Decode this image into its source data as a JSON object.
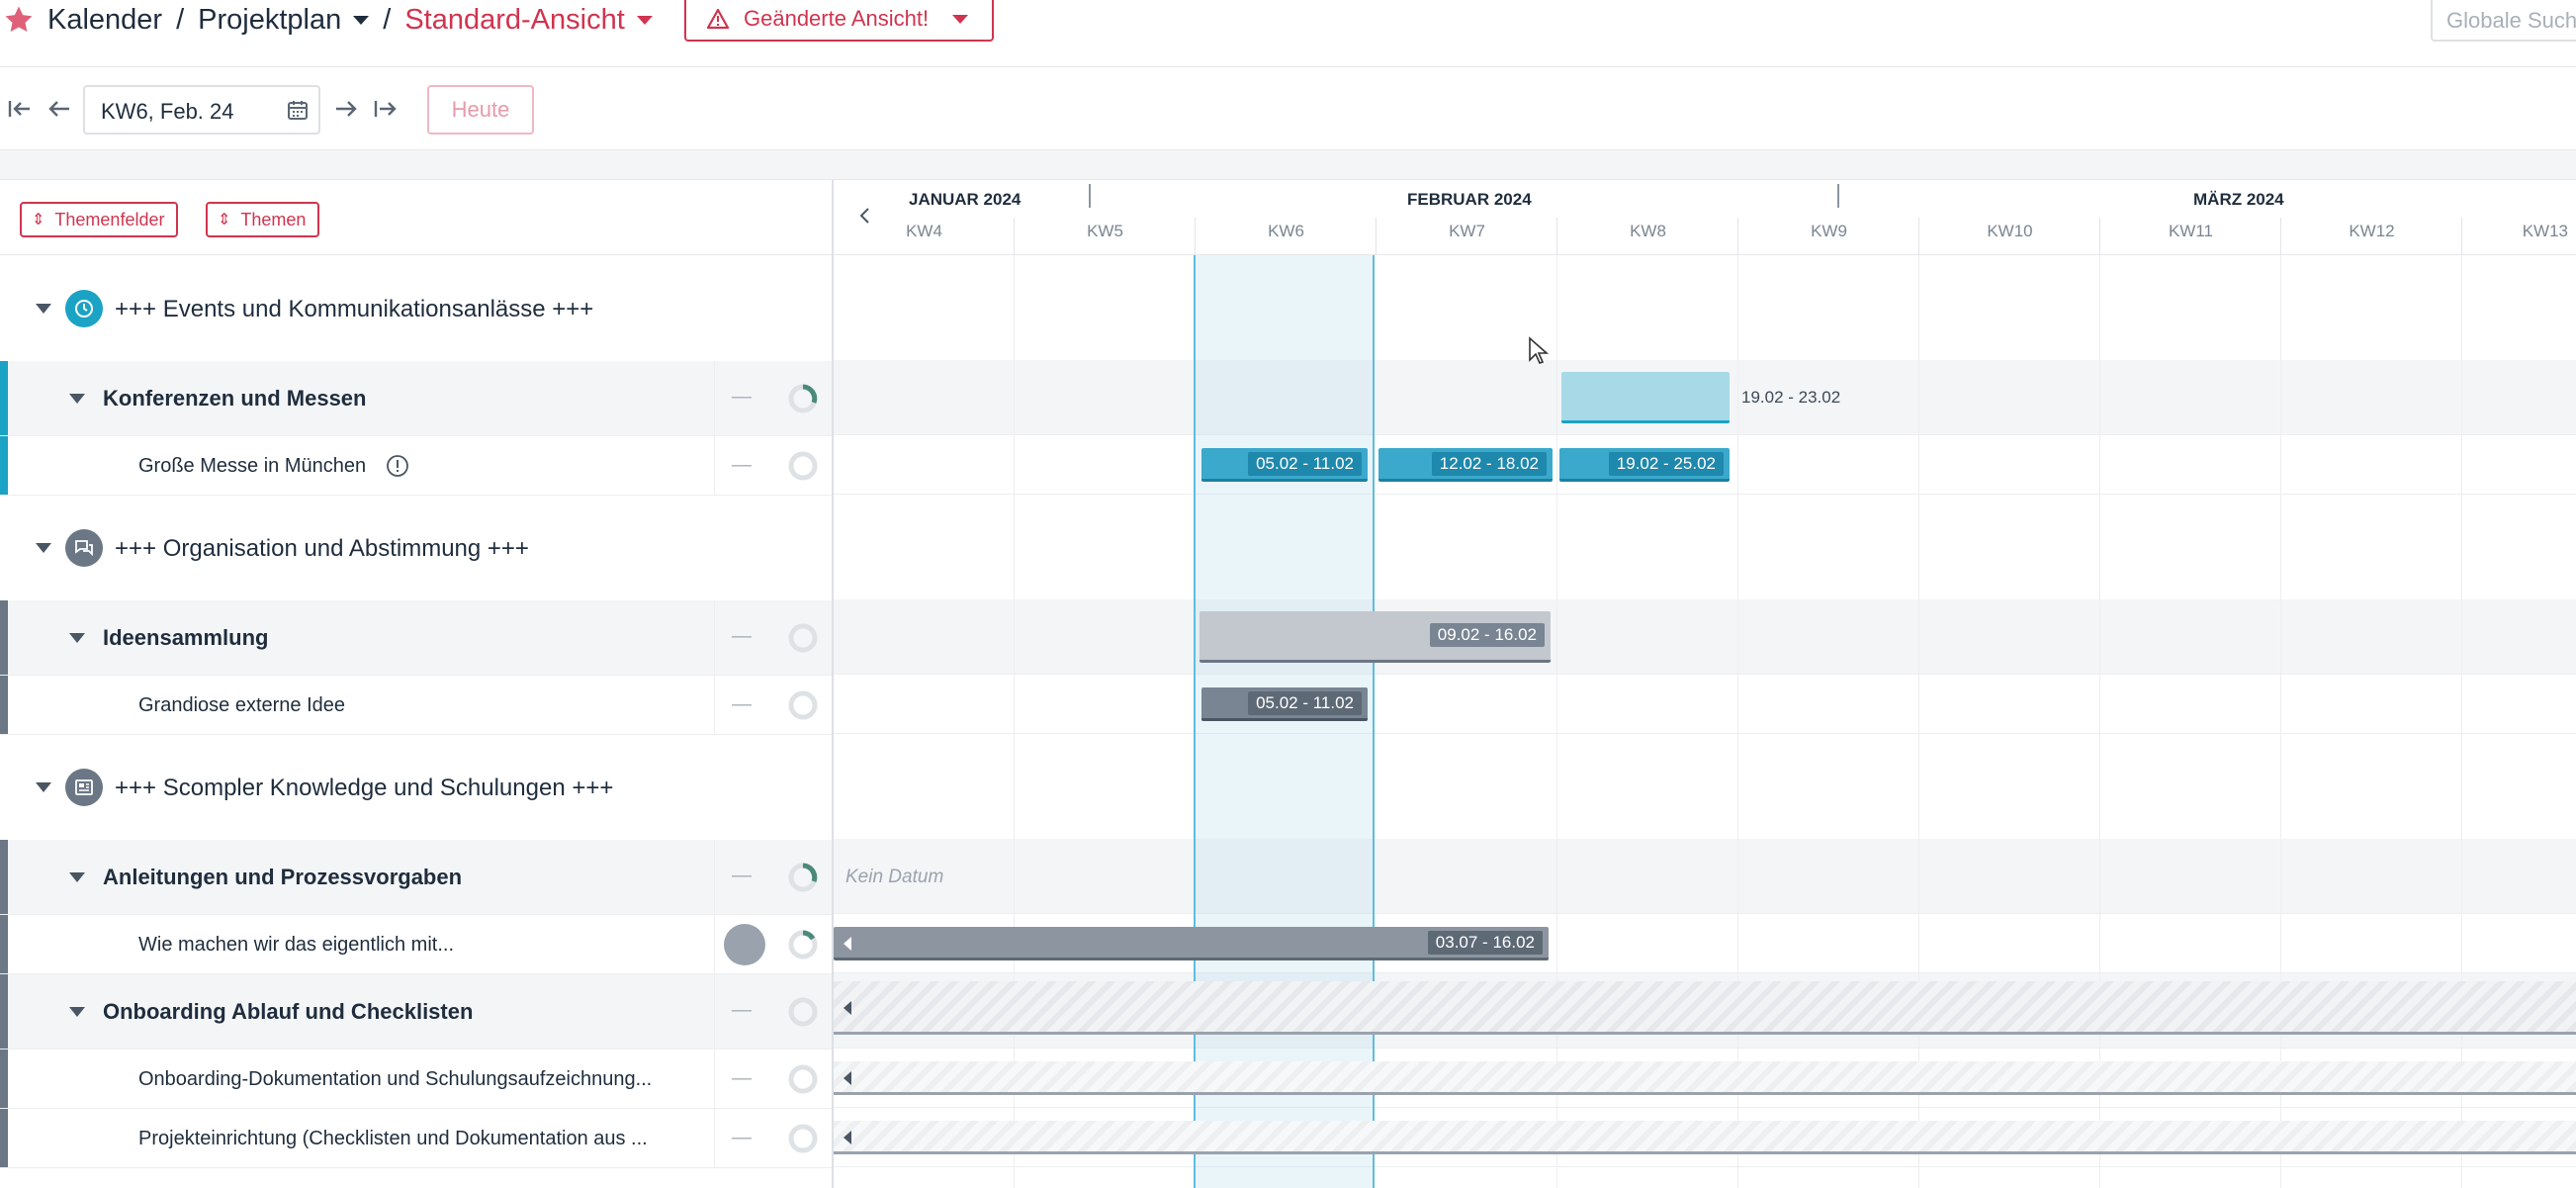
{
  "header": {
    "breadcrumb": [
      "Kalender",
      "Projektplan",
      "Standard-Ansicht"
    ],
    "separator": "/",
    "changed_view_label": "Geänderte Ansicht!",
    "search_placeholder": "Globale Suche..."
  },
  "datenav": {
    "current_week": "KW6, Feb. 24",
    "today_label": "Heute"
  },
  "filters": {
    "themenfelder_label": "Themenfelder",
    "themen_label": "Themen"
  },
  "timeline": {
    "months": [
      {
        "label": "JANUAR 2024"
      },
      {
        "label": "FEBRUAR 2024"
      },
      {
        "label": "MÄRZ 2024"
      }
    ],
    "weeks": [
      "KW4",
      "KW5",
      "KW6",
      "KW7",
      "KW8",
      "KW9",
      "KW10",
      "KW11",
      "KW12",
      "KW13"
    ]
  },
  "groups": [
    {
      "title": "+++ Events und Kommunikationsanlässe +++",
      "color": "#1aa3c4",
      "categories": [
        {
          "title": "Konferenzen und Messen",
          "dash": "—",
          "bar_label": "19.02 - 23.02",
          "items": [
            {
              "title": "Große Messe in München",
              "dash": "—",
              "bars": [
                "05.02 - 11.02",
                "12.02 - 18.02",
                "19.02 - 25.02"
              ]
            }
          ]
        }
      ]
    },
    {
      "title": "+++ Organisation und Abstimmung +++",
      "color": "#6b7785",
      "categories": [
        {
          "title": "Ideensammlung",
          "dash": "—",
          "bar_label": "09.02 - 16.02",
          "items": [
            {
              "title": "Grandiose externe Idee",
              "dash": "—",
              "bars": [
                "05.02 - 11.02"
              ]
            }
          ]
        }
      ]
    },
    {
      "title": "+++ Scompler Knowledge und Schulungen +++",
      "color": "#6b7785",
      "categories": [
        {
          "title": "Anleitungen und Prozessvorgaben",
          "dash": "—",
          "no_date_label": "Kein Datum",
          "items": [
            {
              "title": "Wie machen wir das eigentlich mit...",
              "bars": [
                "03.07 - 16.02"
              ]
            }
          ]
        },
        {
          "title": "Onboarding Ablauf und Checklisten",
          "dash": "—",
          "items": [
            {
              "title": "Onboarding-Dokumentation und Schulungsaufzeichnung...",
              "dash": "—"
            },
            {
              "title": "Projekteinrichtung (Checklisten und Dokumentation aus ...",
              "dash": "—"
            }
          ]
        }
      ]
    }
  ],
  "colors": {
    "brand": "#d0344f",
    "event_blue": "#1aa3c4",
    "event_bar": "#3aa9cc",
    "event_bar_light": "#a8d9e6",
    "org_gray": "#6b7785",
    "org_bar": "#7a8593",
    "org_bar_light": "#c3c8ce"
  }
}
